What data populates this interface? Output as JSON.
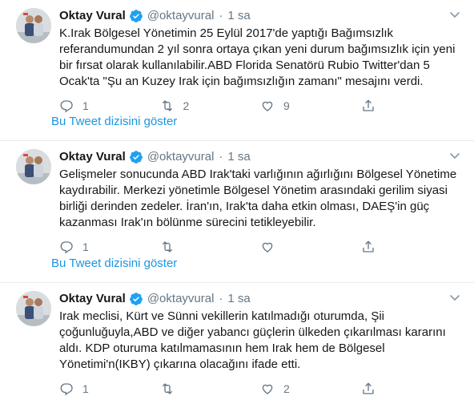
{
  "colors": {
    "accent": "#1b95e0",
    "verified": "#1da1f2",
    "muted": "#657786",
    "text": "#14171a",
    "divider": "#e6ecf0"
  },
  "tweets": [
    {
      "name": "Oktay Vural",
      "handle": "@oktayvural",
      "separator": "·",
      "time": "1 sa",
      "text": "K.Irak Bölgesel Yönetimin 25 Eylül 2017'de yaptığı Bağımsızlık referandumundan 2 yıl sonra ortaya çıkan yeni durum bağımsızlık için yeni bir fırsat olarak kullanılabilir.ABD Florida Senatörü Rubio Twitter'dan 5 Ocak'ta \"Şu an Kuzey Irak için bağımsızlığın zamanı\" mesajını verdi.",
      "replies": "1",
      "retweets": "2",
      "likes": "9",
      "show_thread": "Bu Tweet dizisini göster"
    },
    {
      "name": "Oktay Vural",
      "handle": "@oktayvural",
      "separator": "·",
      "time": "1 sa",
      "text": "Gelişmeler sonucunda ABD Irak'taki varlığının ağırlığını Bölgesel Yönetime kaydırabilir. Merkezi yönetimle Bölgesel Yönetim arasındaki gerilim siyasi birliği derinden zedeler. İran'ın, Irak'ta daha etkin olması, DAEŞ'in güç kazanması Irak'ın bölünme sürecini tetikleyebilir.",
      "replies": "1",
      "retweets": "",
      "likes": "",
      "show_thread": "Bu Tweet dizisini göster"
    },
    {
      "name": "Oktay Vural",
      "handle": "@oktayvural",
      "separator": "·",
      "time": "1 sa",
      "text": "Irak meclisi, Kürt ve Sünni vekillerin katılmadığı oturumda, Şii çoğunluğuyla,ABD ve diğer yabancı güçlerin ülkeden çıkarılması kararını aldı. KDP oturuma katılmamasının hem Irak hem de Bölgesel Yönetimi'n(IKBY) çıkarına olacağını ifade etti.",
      "replies": "1",
      "retweets": "",
      "likes": "2",
      "show_thread": ""
    }
  ],
  "icons": {
    "verified": "verified-badge-icon",
    "caret": "chevron-down-icon",
    "reply": "reply-icon",
    "retweet": "retweet-icon",
    "like": "heart-icon",
    "share": "share-icon"
  }
}
